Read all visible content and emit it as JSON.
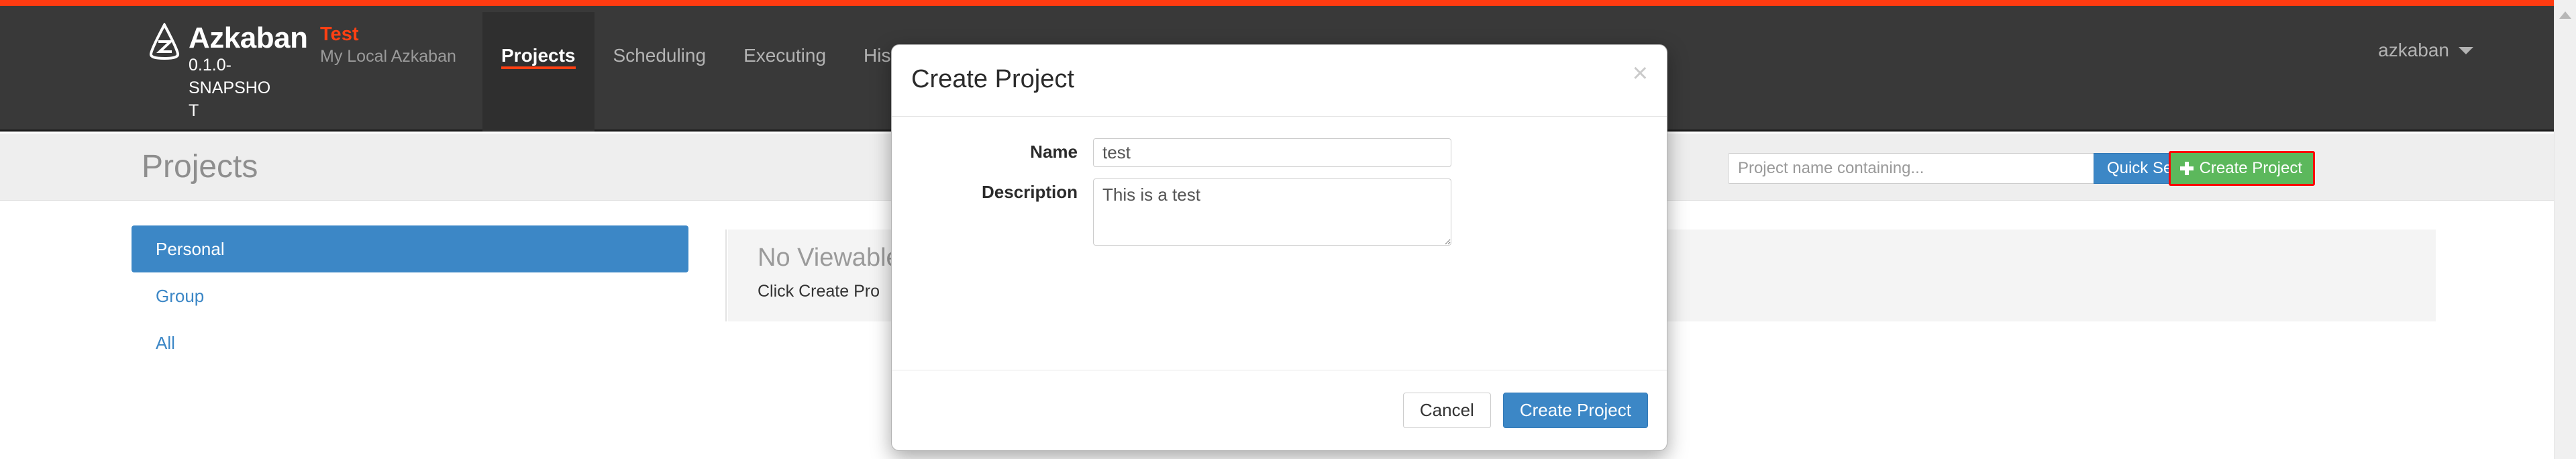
{
  "topbar": {
    "accent_color": "#ff3b11"
  },
  "navbar": {
    "brand": {
      "logo_icon": "azkaban-logo-icon",
      "name": "Azkaban",
      "version": "0.1.0-SNAPSHOT",
      "tag": "Test",
      "tag_color": "#ff4013",
      "subtitle": "My Local Azkaban"
    },
    "links": [
      {
        "label": "Projects",
        "active": true
      },
      {
        "label": "Scheduling",
        "active": false
      },
      {
        "label": "Executing",
        "active": false
      },
      {
        "label": "History",
        "active": false
      }
    ],
    "user": {
      "name": "azkaban",
      "caret_icon": "chevron-down-icon"
    }
  },
  "page_header": {
    "title": "Projects",
    "search": {
      "placeholder": "Project name containing...",
      "value": "",
      "button_label": "Quick Search",
      "button_color": "#3c87c6"
    },
    "create_button": {
      "label": "Create Project",
      "icon": "plus-icon",
      "color": "#5cb85c",
      "highlight_color": "#ff0000"
    }
  },
  "sidebar": {
    "items": [
      {
        "label": "Personal",
        "active": true
      },
      {
        "label": "Group",
        "active": false
      },
      {
        "label": "All",
        "active": false
      }
    ],
    "active_color": "#3c87c6"
  },
  "main": {
    "empty_state": {
      "title": "No Viewable",
      "subtitle": "Click Create Pro"
    }
  },
  "scrollbar": {
    "up_arrow_icon": "caret-up-icon"
  },
  "modal": {
    "title": "Create Project",
    "close_icon": "close-icon",
    "close_label": "×",
    "fields": [
      {
        "label": "Name",
        "value": "test",
        "placeholder": ""
      },
      {
        "label": "Description",
        "value": "This is a test",
        "placeholder": ""
      }
    ],
    "buttons": {
      "cancel": "Cancel",
      "submit": "Create Project",
      "submit_color": "#3c87c6"
    }
  }
}
